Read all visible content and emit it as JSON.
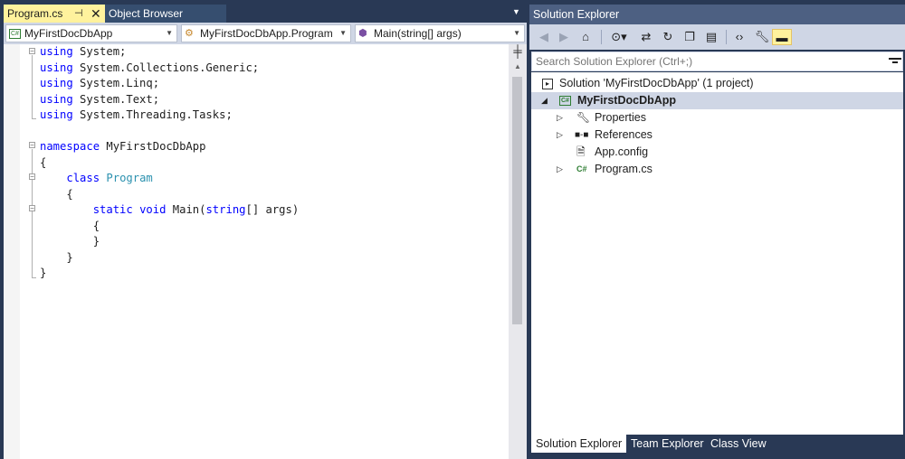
{
  "editor": {
    "tabs": [
      {
        "label": "Program.cs",
        "pin": "⊣",
        "close": "✕"
      },
      {
        "label": "Object Browser"
      }
    ],
    "overflow_icon": "chevron-down-icon",
    "nav_bar": {
      "project": "MyFirstDocDbApp",
      "class": "MyFirstDocDbApp.Program",
      "member": "Main(string[] args)"
    },
    "code": [
      [
        {
          "t": "using",
          "c": "kw"
        },
        {
          "t": " System;"
        }
      ],
      [
        {
          "t": "using",
          "c": "kw"
        },
        {
          "t": " System.Collections.Generic;"
        }
      ],
      [
        {
          "t": "using",
          "c": "kw"
        },
        {
          "t": " System.Linq;"
        }
      ],
      [
        {
          "t": "using",
          "c": "kw"
        },
        {
          "t": " System.Text;"
        }
      ],
      [
        {
          "t": "using",
          "c": "kw"
        },
        {
          "t": " System.Threading.Tasks;"
        }
      ],
      [],
      [
        {
          "t": "namespace",
          "c": "kw"
        },
        {
          "t": " MyFirstDocDbApp"
        }
      ],
      [
        {
          "t": "{"
        }
      ],
      [
        {
          "t": "    "
        },
        {
          "t": "class",
          "c": "kw"
        },
        {
          "t": " "
        },
        {
          "t": "Program",
          "c": "type"
        }
      ],
      [
        {
          "t": "    {"
        }
      ],
      [
        {
          "t": "        "
        },
        {
          "t": "static",
          "c": "kw"
        },
        {
          "t": " "
        },
        {
          "t": "void",
          "c": "kw"
        },
        {
          "t": " Main("
        },
        {
          "t": "string",
          "c": "kw"
        },
        {
          "t": "[] args)"
        }
      ],
      [
        {
          "t": "        {"
        }
      ],
      [
        {
          "t": "        }"
        }
      ],
      [
        {
          "t": "    }"
        }
      ],
      [
        {
          "t": "}"
        }
      ]
    ]
  },
  "solution_explorer": {
    "title": "Solution Explorer",
    "search_placeholder": "Search Solution Explorer (Ctrl+;)",
    "toolbar_icons": [
      "back-icon",
      "forward-icon",
      "home-icon",
      "pending-changes-icon",
      "sync-icon",
      "refresh-icon",
      "collapse-all-icon",
      "show-all-files-icon",
      "view-code-icon",
      "properties-icon",
      "preview-icon"
    ],
    "tree": [
      {
        "label": "Solution 'MyFirstDocDbApp' (1 project)",
        "icon": "solution-icon",
        "expander": ""
      },
      {
        "label": "MyFirstDocDbApp",
        "icon": "csharp-project-icon",
        "expander": "◢",
        "selected": true
      },
      {
        "label": "Properties",
        "icon": "wrench-icon",
        "expander": "▷"
      },
      {
        "label": "References",
        "icon": "references-icon",
        "expander": "▷"
      },
      {
        "label": "App.config",
        "icon": "config-file-icon",
        "expander": ""
      },
      {
        "label": "Program.cs",
        "icon": "csharp-file-icon",
        "expander": "▷"
      }
    ],
    "bottom_tabs": [
      "Solution Explorer",
      "Team Explorer",
      "Class View"
    ]
  }
}
